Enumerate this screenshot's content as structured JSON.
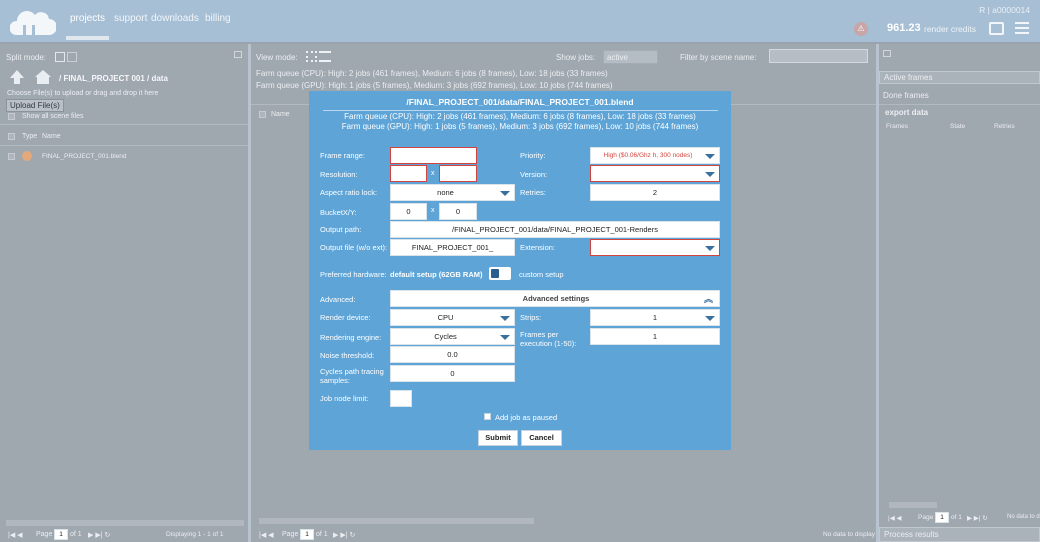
{
  "header": {
    "nav": [
      "projects",
      "support",
      "downloads",
      "billing"
    ],
    "user": "R | a0000014",
    "credits_value": "961.23",
    "credits_label": "render credits"
  },
  "left": {
    "split_mode": "Split mode:",
    "breadcrumb": "/ FINAL_PROJECT 001 / data",
    "upload_hint": "Choose File(s) to upload or drag and drop it here",
    "upload_button": "Upload File(s)",
    "show_all": "Show all scene files",
    "col_type": "Type",
    "col_name": "Name",
    "file": "FINAL_PROJECT_001.blend",
    "pager_page": "Page",
    "pager_of": "of 1",
    "pager_num": "1",
    "displaying": "Displaying 1 - 1 of 1"
  },
  "mid": {
    "view_mode": "View mode:",
    "show_jobs": "Show jobs:",
    "show_jobs_value": "active",
    "filter": "Filter by scene name:",
    "queue_cpu": "Farm queue (CPU): High: 2 jobs (461 frames), Medium: 6 jobs (8 frames), Low: 18 jobs (33 frames)",
    "queue_gpu": "Farm queue (GPU): High: 1 jobs (5 frames), Medium: 3 jobs (692 frames), Low: 10 jobs (744 frames)",
    "col_name": "Name",
    "pager_page": "Page",
    "pager_of": "of 1",
    "pager_num": "1",
    "no_data": "No data to display"
  },
  "right": {
    "active_frames": "Active frames",
    "done_frames": "Done frames",
    "export": "export data",
    "col_frames": "Frames",
    "col_state": "State",
    "col_retries": "Retries",
    "pager_page": "Page",
    "pager_of": "of 1",
    "pager_num": "1",
    "no_data": "No data to d",
    "process_results": "Process results"
  },
  "modal": {
    "title": "/FINAL_PROJECT_001/data/FINAL_PROJECT_001.blend",
    "queue_cpu": "Farm queue (CPU): High: 2 jobs (461 frames), Medium: 6 jobs (8 frames), Low: 18 jobs (33 frames)",
    "queue_gpu": "Farm queue (GPU): High: 1 jobs (5 frames), Medium: 3 jobs (692 frames), Low: 10 jobs (744 frames)",
    "frame_range": "Frame range:",
    "resolution": "Resolution:",
    "aspect": "Aspect ratio lock:",
    "aspect_value": "none",
    "bucket": "BucketX/Y:",
    "bucket_x": "0",
    "bucket_y": "0",
    "x": "x",
    "output_path": "Output path:",
    "output_path_value": "/FINAL_PROJECT_001/data/FINAL_PROJECT_001-Renders",
    "output_file": "Output file (w/o ext):",
    "output_file_value": "FINAL_PROJECT_001_",
    "priority": "Priority:",
    "priority_value": "High ($0.06/Ghz h, 300 nodes)",
    "version": "Version:",
    "retries": "Retries:",
    "retries_value": "2",
    "extension": "Extension:",
    "pref_hw": "Preferred hardware:",
    "pref_hw_value": "default setup (62GB RAM)",
    "custom_setup": "custom setup",
    "advanced": "Advanced:",
    "advanced_settings": "Advanced settings",
    "render_device": "Render device:",
    "render_device_value": "CPU",
    "engine": "Rendering engine:",
    "engine_value": "Cycles",
    "noise": "Noise threshold:",
    "noise_value": "0.0",
    "cycles_samples": "Cycles path tracing samples:",
    "cycles_samples_value": "0",
    "job_node_limit": "Job node limit:",
    "strips": "Strips:",
    "strips_value": "1",
    "frames_per": "Frames per execution (1-50):",
    "frames_per_value": "1",
    "add_paused": "Add job as paused",
    "submit": "Submit",
    "cancel": "Cancel"
  },
  "colors": {
    "modal_bg": "#5ea4d7",
    "error_border": "#d2453f",
    "priority_text": "#d2453f"
  }
}
